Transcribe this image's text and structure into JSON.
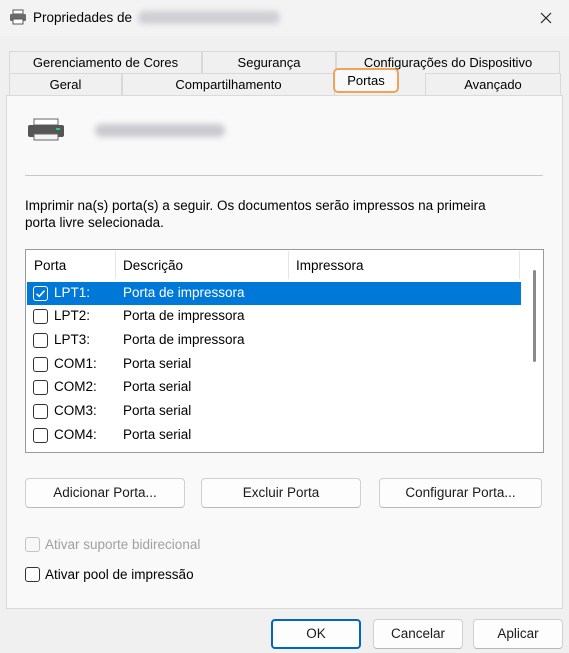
{
  "window": {
    "title": "Propriedades de"
  },
  "tabs_row1": [
    {
      "label": "Gerenciamento de Cores"
    },
    {
      "label": "Segurança"
    },
    {
      "label": "Configurações do Dispositivo"
    }
  ],
  "tabs_row2": [
    {
      "label": "Geral"
    },
    {
      "label": "Compartilhamento"
    },
    {
      "label": "Portas",
      "active": true
    },
    {
      "label": "Avançado"
    }
  ],
  "description": "Imprimir na(s) porta(s) a seguir. Os documentos serão impressos na primeira porta livre selecionada.",
  "ports_table": {
    "columns": [
      "Porta",
      "Descrição",
      "Impressora"
    ],
    "rows": [
      {
        "port": "LPT1:",
        "description": "Porta de impressora",
        "checked": true,
        "selected": true
      },
      {
        "port": "LPT2:",
        "description": "Porta de impressora",
        "checked": false
      },
      {
        "port": "LPT3:",
        "description": "Porta de impressora",
        "checked": false
      },
      {
        "port": "COM1:",
        "description": "Porta serial",
        "checked": false
      },
      {
        "port": "COM2:",
        "description": "Porta serial",
        "checked": false
      },
      {
        "port": "COM3:",
        "description": "Porta serial",
        "checked": false
      },
      {
        "port": "COM4:",
        "description": "Porta serial",
        "checked": false
      }
    ]
  },
  "port_buttons": {
    "add": "Adicionar Porta...",
    "delete": "Excluir Porta",
    "configure": "Configurar Porta..."
  },
  "options": {
    "bidirectional": {
      "label": "Ativar suporte bidirecional",
      "checked": false,
      "enabled": false
    },
    "pooling": {
      "label": "Ativar pool de impressão",
      "checked": false,
      "enabled": true
    }
  },
  "dialog_buttons": {
    "ok": "OK",
    "cancel": "Cancelar",
    "apply": "Aplicar"
  },
  "colors": {
    "selection": "#0078d7",
    "focus_tab": "#f0a25a",
    "primary_border": "#0067c0"
  }
}
